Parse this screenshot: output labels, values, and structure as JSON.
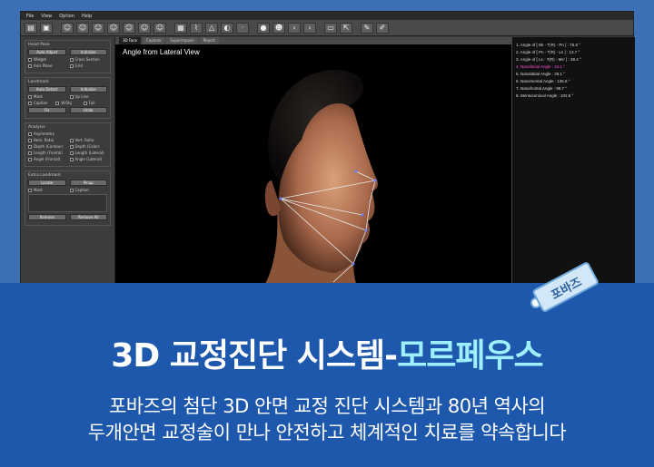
{
  "menu": [
    "File",
    "View",
    "Option",
    "Help"
  ],
  "tabs": [
    "3D Face",
    "Cephalo",
    "Superimpose",
    "Report"
  ],
  "viewport_title": "Angle from Lateral View",
  "left_panel": {
    "group1_title": "Head Pose",
    "auto_adjust": "Auto Adjust",
    "initialize": "Initialize",
    "widget": "Widget",
    "cross_section": "Cross Section",
    "axis_plane": "Axis Plane",
    "grid": "Grid",
    "group2_title": "Landmark",
    "auto_detect": "Auto Detect",
    "initialize2": "Initialize",
    "mark": "Mark",
    "up_line": "Up Line",
    "caption": "Caption",
    "w_obj": "W.Obj",
    "full": "Full",
    "fix": "Fix",
    "undo": "Undo",
    "group3_title": "Analysis",
    "asymmetry": "Asymmetry",
    "horz_ratio": "Horz. Ratio",
    "vert_ratio": "Vert. Ratio",
    "depth_contour": "Depth (Contour)",
    "depth_color": "Depth (Color)",
    "length_frontal": "Length (Frontal)",
    "length_lateral": "Length (Lateral)",
    "angle_frontal": "Angle (Frontal)",
    "angle_lateral": "Angle (Lateral)",
    "group4_title": "Extra Landmark",
    "locate": "Locate",
    "pinup": "Pinup",
    "mark2": "Mark",
    "caption2": "Caption",
    "remove": "Remove",
    "remove_all": "Remove All"
  },
  "measurements": [
    "1. Angle of [ Nk - T(R) - Pn ] : 75.6 °",
    "2. Angle of [ Pn - T(R) - Ls ] : 13.7 °",
    "3. Angle of [ Ls - T(R) - Me' ] : 38.4 °",
    "4. Nasofacial Angle : 34.1 °",
    "5. Nasolabial Angle : 28.1 °",
    "6. Nasomental Angle : 136.8 °",
    "7. Nasofrontal Angle : 98.7 °",
    "8. Mentocervical Angle : 102.5 °"
  ],
  "highlight_index": 3,
  "tag_label": "포바즈",
  "headline_main": "3D 교정진단 시스템-",
  "headline_accent": "모르페우스",
  "sub_line1": "포바즈의 첨단 3D 안면 교정 진단 시스템과 80년 역사의",
  "sub_line2": "두개안면 교정술이 만나 안전하고 체계적인 치료를 약속합니다",
  "colors": {
    "banner": "#1e58ad",
    "accent": "#9ef0ff",
    "highlight": "#ff4fd8"
  }
}
